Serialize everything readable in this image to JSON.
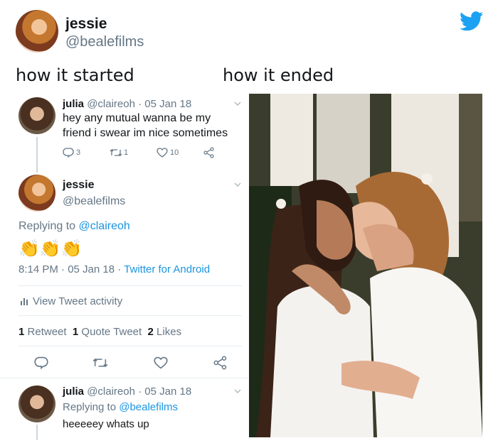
{
  "header": {
    "name": "jessie",
    "handle": "@bealefilms"
  },
  "captions": {
    "left": "how it started",
    "right": "how it ended"
  },
  "tweet1": {
    "name": "julia",
    "handle": "@claireoh",
    "date": "· 05 Jan 18",
    "text_line1": "hey any mutual wanna be my",
    "text_line2": "friend i swear im nice sometimes",
    "replies": "3",
    "retweets": "1",
    "likes": "10"
  },
  "tweet2": {
    "name": "jessie",
    "handle": "@bealefilms",
    "replying_prefix": "Replying to",
    "replying_to": "@claireoh",
    "emoji": "👏👏👏",
    "time": "8:14 PM · 05 Jan 18 ·",
    "source": "Twitter for Android",
    "activity": "View Tweet activity",
    "retweet_count": "1",
    "retweet_label": "Retweet",
    "quote_count": "1",
    "quote_label": "Quote Tweet",
    "like_count": "2",
    "like_label": "Likes"
  },
  "tweet3": {
    "name": "julia",
    "handle": "@claireoh",
    "date": "· 05 Jan 18",
    "replying_prefix": "Replying to",
    "replying_to": "@bealefilms",
    "text": "heeeeey whats up"
  },
  "colors": {
    "twitter_blue": "#1da1f2",
    "link_blue": "#1b95e0",
    "gray": "#657786",
    "divider": "#e6ecf0"
  }
}
